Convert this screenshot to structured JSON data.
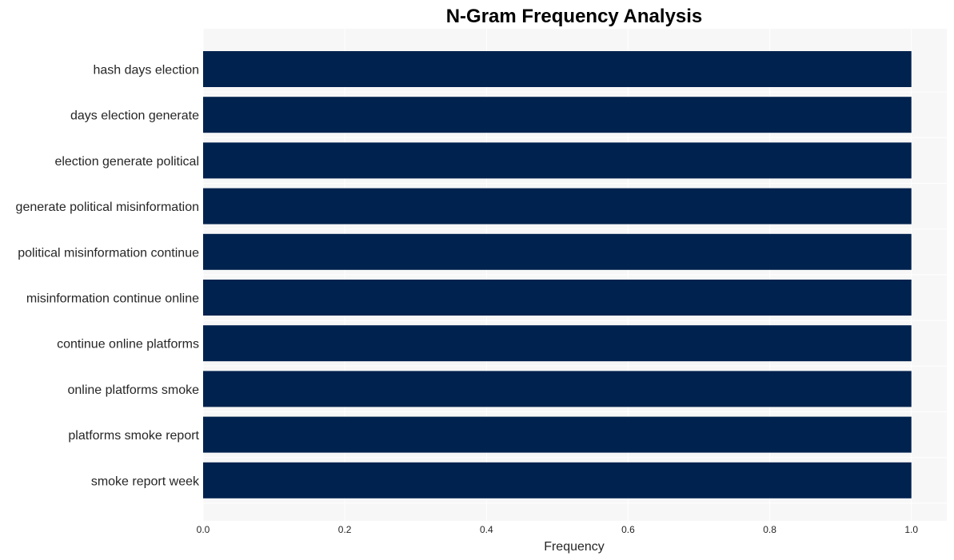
{
  "chart_data": {
    "type": "bar",
    "orientation": "horizontal",
    "title": "N-Gram Frequency Analysis",
    "xlabel": "Frequency",
    "ylabel": "",
    "categories": [
      "hash days election",
      "days election generate",
      "election generate political",
      "generate political misinformation",
      "political misinformation continue",
      "misinformation continue online",
      "continue online platforms",
      "online platforms smoke",
      "platforms smoke report",
      "smoke report week"
    ],
    "values": [
      1.0,
      1.0,
      1.0,
      1.0,
      1.0,
      1.0,
      1.0,
      1.0,
      1.0,
      1.0
    ],
    "xlim": [
      0.0,
      1.05
    ],
    "xticks": [
      0.0,
      0.2,
      0.4,
      0.6,
      0.8,
      1.0
    ],
    "xtick_labels": [
      "0.0",
      "0.2",
      "0.4",
      "0.6",
      "0.8",
      "1.0"
    ],
    "grid": true,
    "legend": "none",
    "colors": {
      "bar": "#00224E",
      "plot_background": "#F7F7F7",
      "grid": "#FFFFFF"
    }
  }
}
